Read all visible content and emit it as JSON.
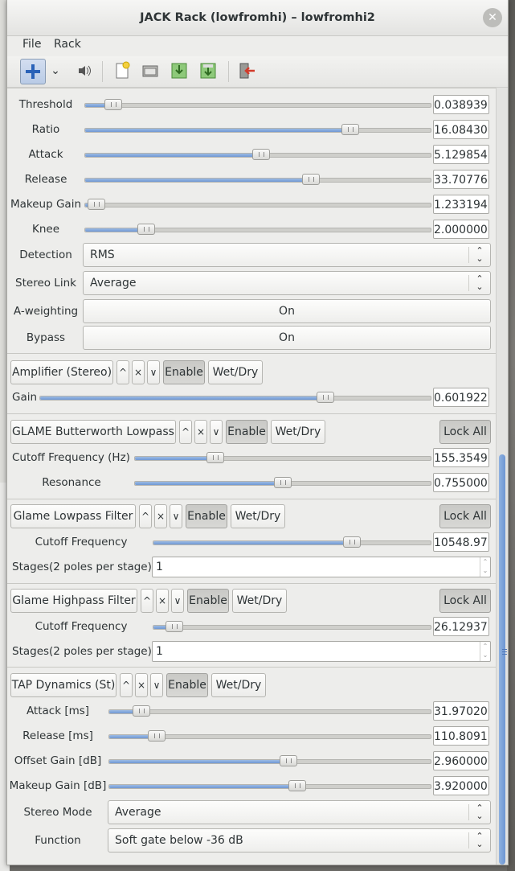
{
  "window": {
    "title": "JACK Rack (lowfromhi) – lowfromhi2",
    "close_glyph": "✕"
  },
  "menu": {
    "file": "File",
    "rack": "Rack"
  },
  "toolbar": {
    "icons": [
      "add-plugin-icon",
      "dropdown-chevron-icon",
      "speaker-icon",
      "new-icon",
      "open-icon",
      "save-icon",
      "save-as-icon",
      "quit-icon"
    ],
    "chevron_glyph": "⌄"
  },
  "compressor": {
    "rows": [
      {
        "label": "Threshold",
        "value": "0.038939",
        "level": 0.06
      },
      {
        "label": "Ratio",
        "value": "16.08430",
        "level": 0.78
      },
      {
        "label": "Attack",
        "value": "5.129854",
        "level": 0.51
      },
      {
        "label": "Release",
        "value": "33.70776",
        "level": 0.66
      },
      {
        "label": "Makeup Gain",
        "value": "1.233194",
        "level": 0.01
      },
      {
        "label": "Knee",
        "value": "2.000000",
        "level": 0.16
      }
    ],
    "detection": {
      "label": "Detection",
      "value": "RMS"
    },
    "stereo_link": {
      "label": "Stereo Link",
      "value": "Average"
    },
    "a_weighting": {
      "label": "A-weighting",
      "value": "On"
    },
    "bypass": {
      "label": "Bypass",
      "value": "On"
    }
  },
  "plugin_buttons": {
    "up": "^",
    "close": "×",
    "down": "∨",
    "enable": "Enable",
    "wetdry": "Wet/Dry",
    "lockall": "Lock All"
  },
  "amplifier": {
    "name": "Amplifier (Stereo)",
    "gain": {
      "label": "Gain",
      "value": "0.601922",
      "level": 0.74
    }
  },
  "butterworth": {
    "name": "GLAME Butterworth Lowpass",
    "cutoff": {
      "label": "Cutoff Frequency (Hz)",
      "value": "155.3549",
      "level": 0.26
    },
    "resonance": {
      "label": "Resonance",
      "value": "0.755000",
      "level": 0.5
    }
  },
  "lowpass": {
    "name": "Glame Lowpass Filter",
    "cutoff": {
      "label": "Cutoff Frequency",
      "value": "10548.97",
      "level": 0.73
    },
    "stages": {
      "label": "Stages(2 poles per stage)",
      "value": "1"
    }
  },
  "highpass": {
    "name": "Glame Highpass Filter",
    "cutoff": {
      "label": "Cutoff Frequency",
      "value": "26.12937",
      "level": 0.05
    },
    "stages": {
      "label": "Stages(2 poles per stage)",
      "value": "1"
    }
  },
  "tapdyn": {
    "name": "TAP Dynamics (St)",
    "rows": [
      {
        "label": "Attack [ms]",
        "value": "31.97020",
        "level": 0.08
      },
      {
        "label": "Release [ms]",
        "value": "110.8091",
        "level": 0.13
      },
      {
        "label": "Offset Gain [dB]",
        "value": "2.960000",
        "level": 0.56
      },
      {
        "label": "Makeup Gain [dB]",
        "value": "3.920000",
        "level": 0.59
      }
    ],
    "stereo_mode": {
      "label": "Stereo Mode",
      "value": "Average"
    },
    "function": {
      "label": "Function",
      "value": "Soft gate below -36 dB"
    }
  },
  "colors": {
    "accent": "#6f98d4",
    "window_bg": "#ededeb"
  }
}
